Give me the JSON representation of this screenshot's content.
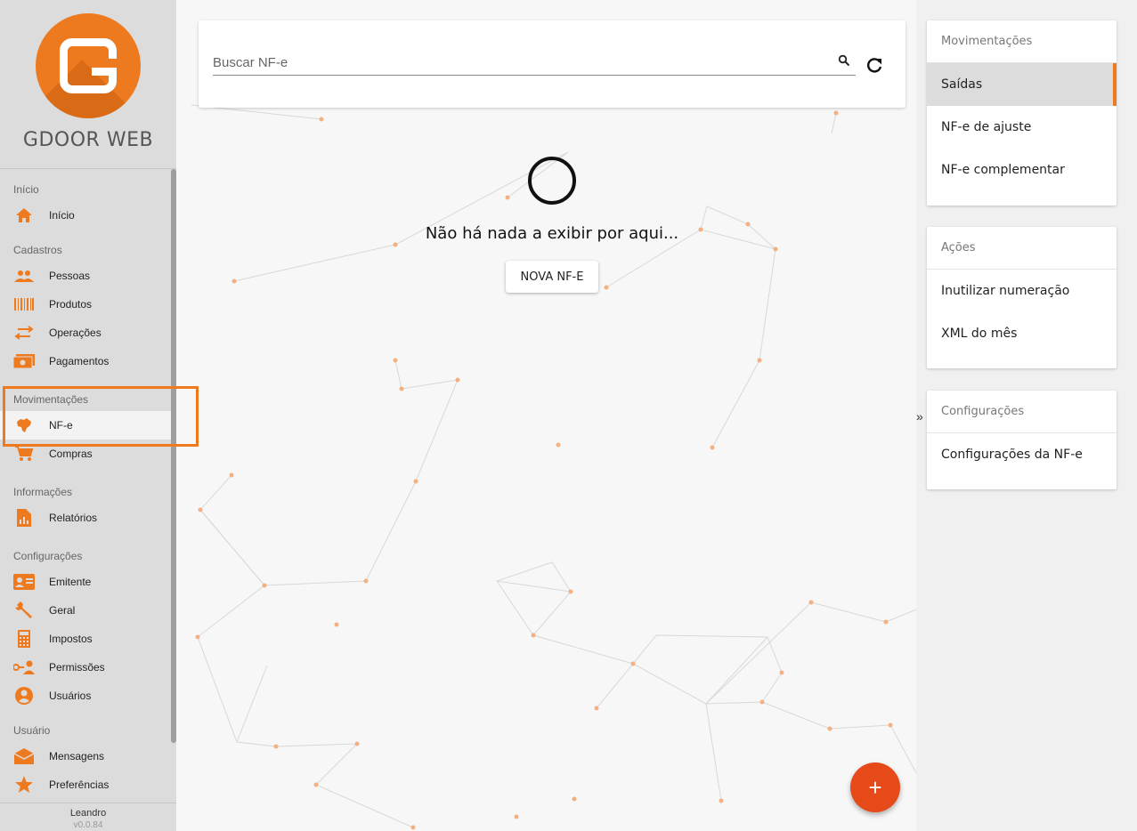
{
  "app": {
    "name": "GDOOR WEB"
  },
  "sidebar": {
    "sections": [
      {
        "title": "Início",
        "items": [
          {
            "label": "Início",
            "icon": "home-icon"
          }
        ]
      },
      {
        "title": "Cadastros",
        "items": [
          {
            "label": "Pessoas",
            "icon": "people-icon"
          },
          {
            "label": "Produtos",
            "icon": "barcode-icon"
          },
          {
            "label": "Operações",
            "icon": "swap-icon"
          },
          {
            "label": "Pagamentos",
            "icon": "money-icon"
          }
        ]
      },
      {
        "title": "Movimentações",
        "items": [
          {
            "label": "NF-e",
            "icon": "brazil-map-icon",
            "active": true
          },
          {
            "label": "Compras",
            "icon": "cart-icon"
          }
        ]
      },
      {
        "title": "Informações",
        "items": [
          {
            "label": "Relatórios",
            "icon": "report-icon"
          }
        ]
      },
      {
        "title": "Configurações",
        "items": [
          {
            "label": "Emitente",
            "icon": "id-card-icon"
          },
          {
            "label": "Geral",
            "icon": "wrench-icon"
          },
          {
            "label": "Impostos",
            "icon": "calculator-icon"
          },
          {
            "label": "Permissões",
            "icon": "key-person-icon"
          },
          {
            "label": "Usuários",
            "icon": "user-circle-icon"
          }
        ]
      },
      {
        "title": "Usuário",
        "items": [
          {
            "label": "Mensagens",
            "icon": "mail-icon"
          },
          {
            "label": "Preferências",
            "icon": "star-icon"
          }
        ]
      }
    ],
    "user": "Leandro",
    "version": "v0.0.84"
  },
  "search": {
    "placeholder": "Buscar NF-e",
    "value": ""
  },
  "empty_state": {
    "message": "Não há nada a exibir por aqui...",
    "button_label": "NOVA NF-E"
  },
  "fab": {
    "label": "+"
  },
  "right_panel": {
    "collapse_label": "»",
    "cards": [
      {
        "title": "Movimentações",
        "items": [
          {
            "label": "Saídas",
            "active": true
          },
          {
            "label": "NF-e de ajuste"
          },
          {
            "label": "NF-e complementar"
          }
        ]
      },
      {
        "title": "Ações",
        "items": [
          {
            "label": "Inutilizar numeração"
          },
          {
            "label": "XML do mês"
          }
        ]
      },
      {
        "title": "Configurações",
        "items": [
          {
            "label": "Configurações da NF-e"
          }
        ]
      }
    ]
  },
  "colors": {
    "accent": "#ee7a1f",
    "fab": "#e64a19",
    "sidebar_bg": "#dcdcdc"
  }
}
